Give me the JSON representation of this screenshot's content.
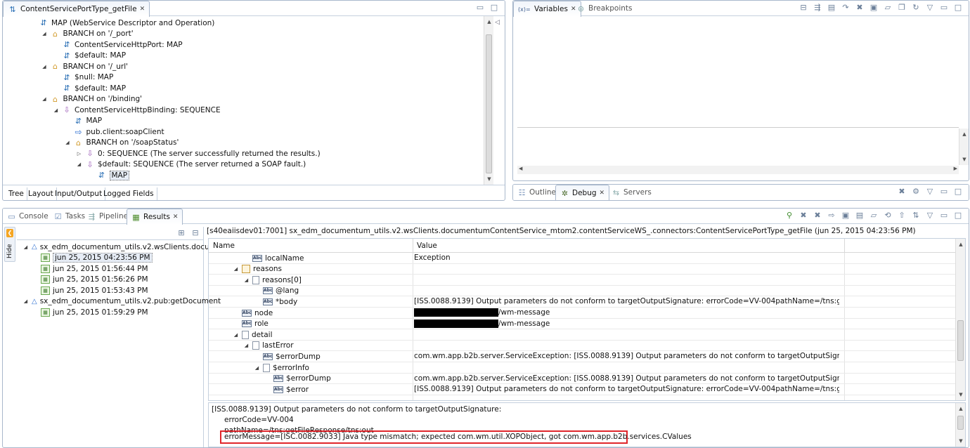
{
  "editor": {
    "tab_title": "ContentServicePortType_getFile",
    "tree": [
      {
        "label": "MAP (WebService Descriptor and Operation)",
        "indent": 0,
        "icon": "flow",
        "tw": ""
      },
      {
        "label": "BRANCH on '/_port'",
        "indent": 1,
        "icon": "branch",
        "tw": "◢"
      },
      {
        "label": "ContentServiceHttpPort: MAP",
        "indent": 2,
        "icon": "flow",
        "tw": ""
      },
      {
        "label": "$default: MAP",
        "indent": 2,
        "icon": "flow",
        "tw": ""
      },
      {
        "label": "BRANCH on '/_url'",
        "indent": 1,
        "icon": "branch",
        "tw": "◢"
      },
      {
        "label": "$null: MAP",
        "indent": 2,
        "icon": "flow",
        "tw": ""
      },
      {
        "label": "$default: MAP",
        "indent": 2,
        "icon": "flow",
        "tw": ""
      },
      {
        "label": "BRANCH on '/binding'",
        "indent": 1,
        "icon": "branch",
        "tw": "◢"
      },
      {
        "label": "ContentServiceHttpBinding: SEQUENCE",
        "indent": 2,
        "icon": "seq",
        "tw": "◢"
      },
      {
        "label": "MAP",
        "indent": 3,
        "icon": "flow",
        "tw": ""
      },
      {
        "label": "pub.client:soapClient",
        "indent": 3,
        "icon": "inv",
        "tw": ""
      },
      {
        "label": "BRANCH on '/soapStatus'",
        "indent": 3,
        "icon": "branch",
        "tw": "◢"
      },
      {
        "label": "0: SEQUENCE (The server successfully returned the results.)",
        "indent": 4,
        "icon": "seq",
        "tw": "▷"
      },
      {
        "label": "$default: SEQUENCE (The server returned a SOAP fault.)",
        "indent": 4,
        "icon": "seq",
        "tw": "◢"
      },
      {
        "label": "MAP",
        "indent": 5,
        "icon": "flow",
        "tw": "",
        "selected": true
      }
    ],
    "bottom_tabs": [
      "Tree",
      "Layout",
      "Input/Output",
      "Logged Fields"
    ]
  },
  "variables_pane": {
    "tabs": [
      "Variables",
      "Breakpoints"
    ]
  },
  "debug_pane": {
    "tabs": [
      "Outline",
      "Debug",
      "Servers"
    ]
  },
  "results_pane": {
    "tabs": [
      "Console",
      "Tasks",
      "Pipeline",
      "Results"
    ],
    "hide_label": "Hide",
    "header": "[s40eaiisdev01:7001] sx_edm_documentum_utils.v2.wsClients.documentumContentService_mtom2.contentServiceWS_.connectors:ContentServicePortType_getFile (jun 25, 2015 04:23:56 PM)",
    "history": [
      {
        "label": "sx_edm_documentum_utils.v2.wsClients.docume",
        "level": 0
      },
      {
        "label": "jun 25, 2015 04:23:56 PM",
        "level": 1,
        "selected": true
      },
      {
        "label": "jun 25, 2015 01:56:44 PM",
        "level": 1
      },
      {
        "label": "jun 25, 2015 01:56:26 PM",
        "level": 1
      },
      {
        "label": "jun 25, 2015 01:53:43 PM",
        "level": 1
      },
      {
        "label": "sx_edm_documentum_utils.v2.pub:getDocument",
        "level": 0
      },
      {
        "label": "jun 25, 2015 01:59:29 PM",
        "level": 1
      }
    ],
    "columns": [
      "Name",
      "Value"
    ],
    "pipeline": [
      {
        "name": "localName",
        "value": "Exception",
        "indent": 3,
        "icon": "abc",
        "tw": ""
      },
      {
        "name": "reasons",
        "value": "",
        "indent": 2,
        "icon": "docs",
        "tw": "◢"
      },
      {
        "name": "reasons[0]",
        "value": "",
        "indent": 3,
        "icon": "doc",
        "tw": "◢"
      },
      {
        "name": "@lang",
        "value": "",
        "indent": 4,
        "icon": "abc",
        "tw": ""
      },
      {
        "name": "*body",
        "value": "[ISS.0088.9139] Output parameters do not conform to targetOutputSignature: errorCode=VV-004pathName=/tns:getFileResponse/t...",
        "indent": 4,
        "icon": "abc",
        "tw": ""
      },
      {
        "name": "node",
        "value": "/wm-message",
        "indent": 2,
        "icon": "abc",
        "tw": "",
        "redacted": true
      },
      {
        "name": "role",
        "value": "/wm-message",
        "indent": 2,
        "icon": "abc",
        "tw": "",
        "redacted": true
      },
      {
        "name": "detail",
        "value": "",
        "indent": 2,
        "icon": "doc",
        "tw": "◢"
      },
      {
        "name": "lastError",
        "value": "",
        "indent": 3,
        "icon": "doc",
        "tw": "◢"
      },
      {
        "name": "$errorDump",
        "value": "com.wm.app.b2b.server.ServiceException: [ISS.0088.9139] Output parameters do not conform to targetOutputSignature: errorCode...",
        "indent": 4,
        "icon": "abc",
        "tw": ""
      },
      {
        "name": "$errorInfo",
        "value": "",
        "indent": 4,
        "icon": "doc",
        "tw": "◢"
      },
      {
        "name": "$errorDump",
        "value": "com.wm.app.b2b.server.ServiceException: [ISS.0088.9139] Output parameters do not conform to targetOutputSignature: errorCode...",
        "indent": 5,
        "icon": "abc",
        "tw": ""
      },
      {
        "name": "$error",
        "value": "[ISS.0088.9139] Output parameters do not conform to targetOutputSignature: errorCode=VV-004pathName=/tns:getFileResponse/t...",
        "indent": 5,
        "icon": "abc",
        "tw": ""
      }
    ],
    "message_lines": [
      "[ISS.0088.9139] Output parameters do not conform to targetOutputSignature:",
      "errorCode=VV-004",
      "pathName=/tns:getFileResponse/tns:out",
      "errorMessage=[ISC.0082.9033] Java type mismatch; expected com.wm.util.XOPObject, got com.wm.app.b2b.services.CValues"
    ],
    "highlight_color": "#e0262b"
  }
}
